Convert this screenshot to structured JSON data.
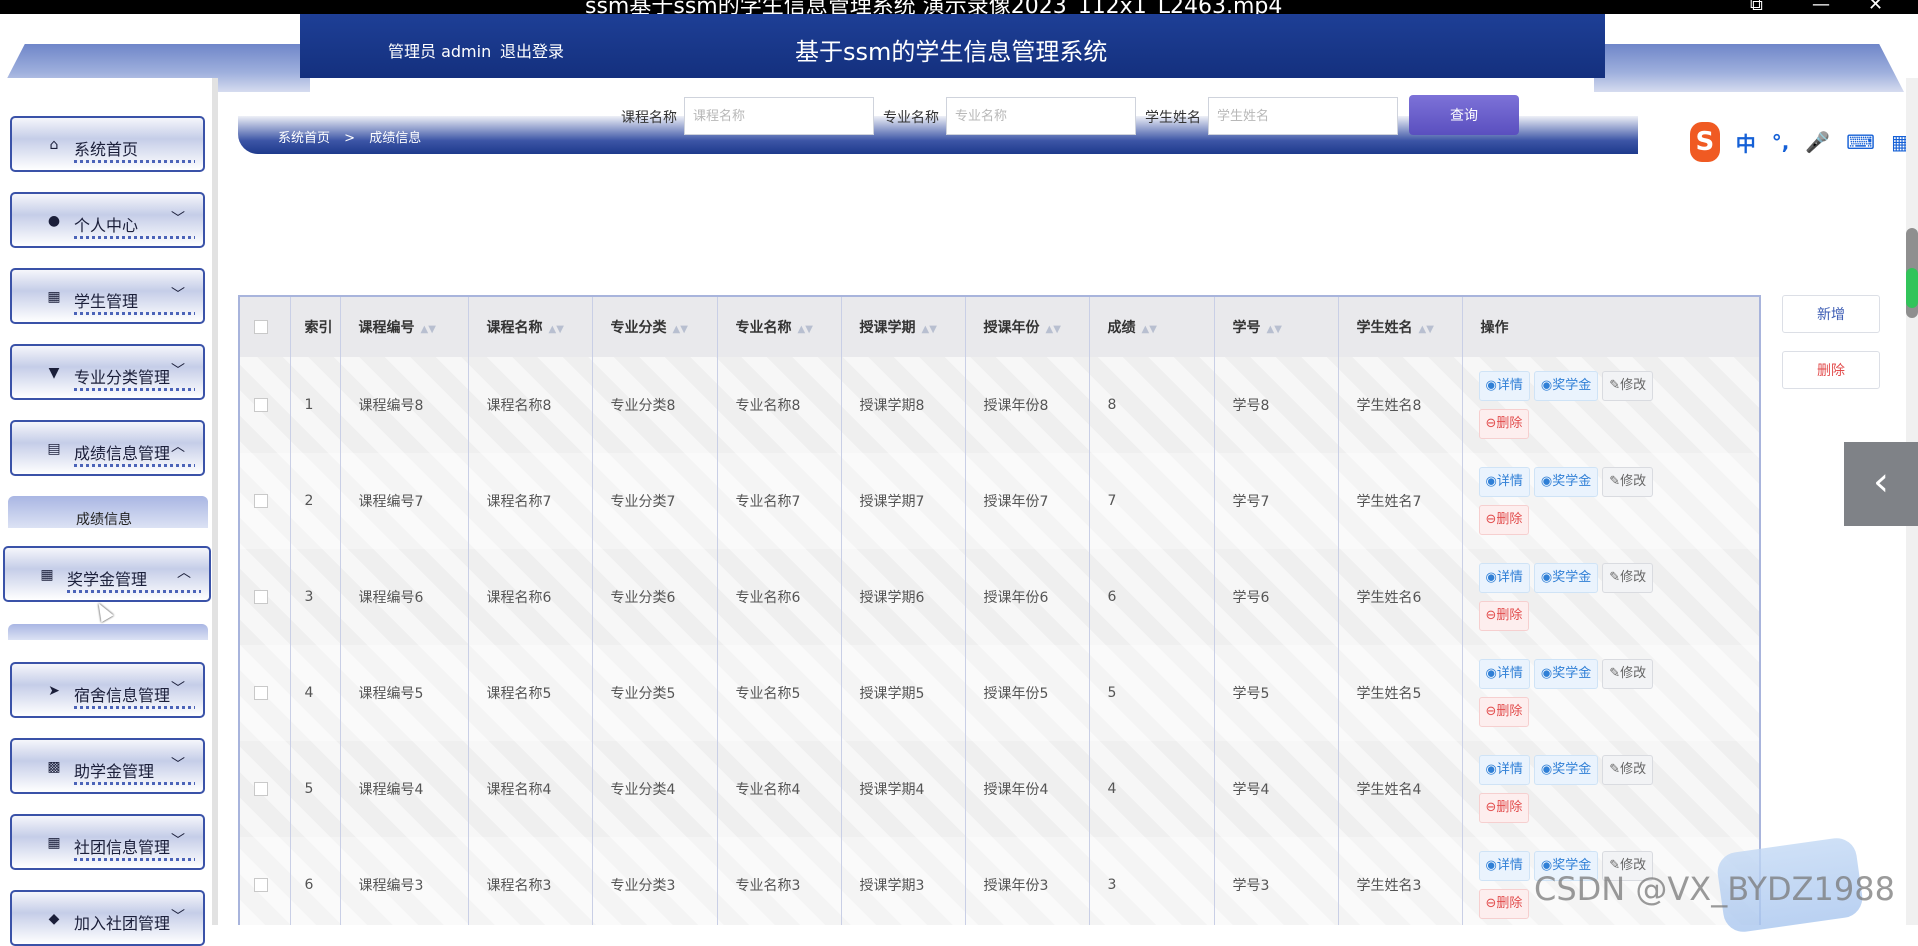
{
  "video": {
    "title": "ssm基于ssm的学生信息管理系统 演示录像2023_112x1_L2463.mp4"
  },
  "header": {
    "admin_text": "管理员 admin",
    "logout_label": "退出登录",
    "title": "基于ssm的学生信息管理系统"
  },
  "sidebar": {
    "items": [
      {
        "label": "系统首页",
        "icon": "home-icon",
        "arrow": ""
      },
      {
        "label": "个人中心",
        "icon": "user-icon",
        "arrow": "﹀"
      },
      {
        "label": "学生管理",
        "icon": "grid-icon",
        "arrow": "﹀"
      },
      {
        "label": "专业分类管理",
        "icon": "cup-icon",
        "arrow": "﹀"
      },
      {
        "label": "成绩信息管理",
        "icon": "clipboard-icon",
        "arrow": "︿"
      },
      {
        "label": "奖学金管理",
        "icon": "grid-icon",
        "arrow": "︿"
      },
      {
        "label": "宿舍信息管理",
        "icon": "send-icon",
        "arrow": "﹀"
      },
      {
        "label": "助学金管理",
        "icon": "apps-icon",
        "arrow": "﹀"
      },
      {
        "label": "社团信息管理",
        "icon": "grid-icon",
        "arrow": "﹀"
      },
      {
        "label": "加入社团管理",
        "icon": "shield-icon",
        "arrow": "﹀"
      }
    ],
    "submenu_label": "成绩信息"
  },
  "breadcrumb": {
    "home": "系统首页",
    "separator": ">",
    "current": "成绩信息"
  },
  "search": {
    "course_label": "课程名称",
    "course_placeholder": "课程名称",
    "major_label": "专业名称",
    "major_placeholder": "专业名称",
    "student_label": "学生姓名",
    "student_placeholder": "学生姓名",
    "query_label": "查询"
  },
  "side_buttons": {
    "add": "新增",
    "delete": "删除"
  },
  "table": {
    "headers": [
      "索引",
      "课程编号",
      "课程名称",
      "专业分类",
      "专业名称",
      "授课学期",
      "授课年份",
      "成绩",
      "学号",
      "学生姓名",
      "操作"
    ],
    "rows": [
      [
        "1",
        "课程编号8",
        "课程名称8",
        "专业分类8",
        "专业名称8",
        "授课学期8",
        "授课年份8",
        "8",
        "学号8",
        "学生姓名8"
      ],
      [
        "2",
        "课程编号7",
        "课程名称7",
        "专业分类7",
        "专业名称7",
        "授课学期7",
        "授课年份7",
        "7",
        "学号7",
        "学生姓名7"
      ],
      [
        "3",
        "课程编号6",
        "课程名称6",
        "专业分类6",
        "专业名称6",
        "授课学期6",
        "授课年份6",
        "6",
        "学号6",
        "学生姓名6"
      ],
      [
        "4",
        "课程编号5",
        "课程名称5",
        "专业分类5",
        "专业名称5",
        "授课学期5",
        "授课年份5",
        "5",
        "学号5",
        "学生姓名5"
      ],
      [
        "5",
        "课程编号4",
        "课程名称4",
        "专业分类4",
        "专业名称4",
        "授课学期4",
        "授课年份4",
        "4",
        "学号4",
        "学生姓名4"
      ],
      [
        "6",
        "课程编号3",
        "课程名称3",
        "专业分类3",
        "专业名称3",
        "授课学期3",
        "授课年份3",
        "3",
        "学号3",
        "学生姓名3"
      ]
    ],
    "ops": {
      "detail": "详情",
      "scholarship": "奖学金",
      "edit": "修改",
      "delete": "删除"
    }
  },
  "ime": {
    "logo": "S",
    "lang": "中",
    "punct": "°,",
    "mic": "🎤",
    "keyboard": "⌨",
    "apps": "▦"
  },
  "watermark": "CSDN @VX_BYDZ1988",
  "colors": {
    "header": "#14307e",
    "accent": "#3a52a8",
    "query": "#6a5fcf",
    "danger": "#e24c4c",
    "link": "#2f7fd6"
  }
}
